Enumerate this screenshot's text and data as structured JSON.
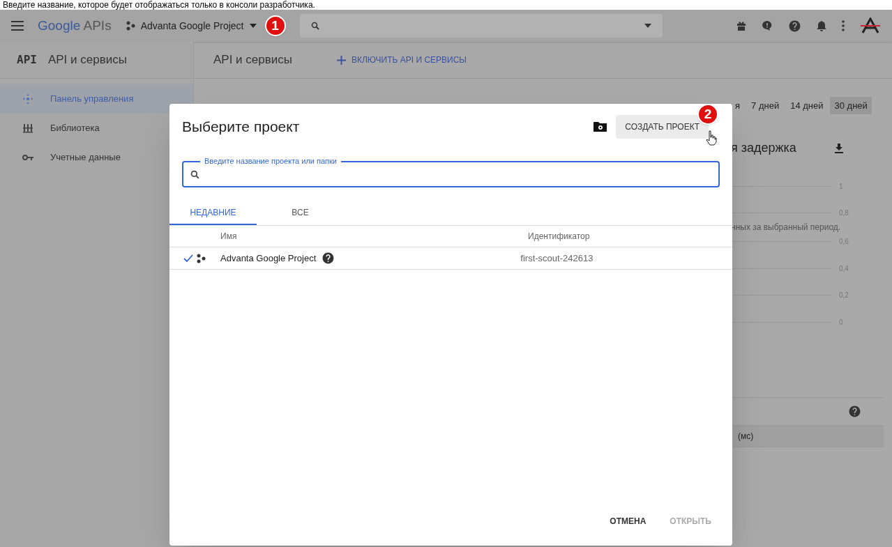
{
  "caption": "Введите название, которое будет отображаться только в консоли разработчика.",
  "topbar": {
    "logo_brand": "Google",
    "logo_product": "APIs",
    "project": "Advanta Google Project"
  },
  "callouts": [
    {
      "label": "1"
    },
    {
      "label": "2"
    }
  ],
  "sidebar": {
    "badge": "API",
    "title": "API и сервисы",
    "items": [
      {
        "label": "Панель управления",
        "kind": "dashboard",
        "selected": true
      },
      {
        "label": "Библиотека",
        "kind": "library",
        "selected": false
      },
      {
        "label": "Учетные данные",
        "kind": "credentials",
        "selected": false
      }
    ]
  },
  "main": {
    "title": "API и сервисы",
    "enable_button": "ВКЛЮЧИТЬ API И СЕРВИСЫ",
    "time_ranges": [
      {
        "label": "я",
        "selected": false
      },
      {
        "label": "7 дней",
        "selected": false
      },
      {
        "label": "14 дней",
        "selected": false
      },
      {
        "label": "30 дней",
        "selected": true
      }
    ],
    "chart_title": "я задержка",
    "chart_ticks": [
      "1",
      "0,8",
      "0,6",
      "0,4",
      "0,2",
      "0"
    ],
    "chart_note": "нных за выбранный период.",
    "table_header": "(мс)"
  },
  "dialog": {
    "title": "Выберите проект",
    "create_button": "СОЗДАТЬ ПРОЕКТ",
    "search_label": "Введите название проекта или папки",
    "tabs": [
      {
        "label": "НЕДАВНИЕ",
        "selected": true
      },
      {
        "label": "ВСЕ",
        "selected": false
      }
    ],
    "columns": [
      "Имя",
      "Идентификатор"
    ],
    "rows": [
      {
        "name": "Advanta Google Project",
        "id": "first-scout-242613",
        "checked": true
      }
    ],
    "buttons": [
      {
        "label": "ОТМЕНА",
        "disabled": false
      },
      {
        "label": "ОТКРЫТЬ",
        "disabled": true
      }
    ]
  }
}
